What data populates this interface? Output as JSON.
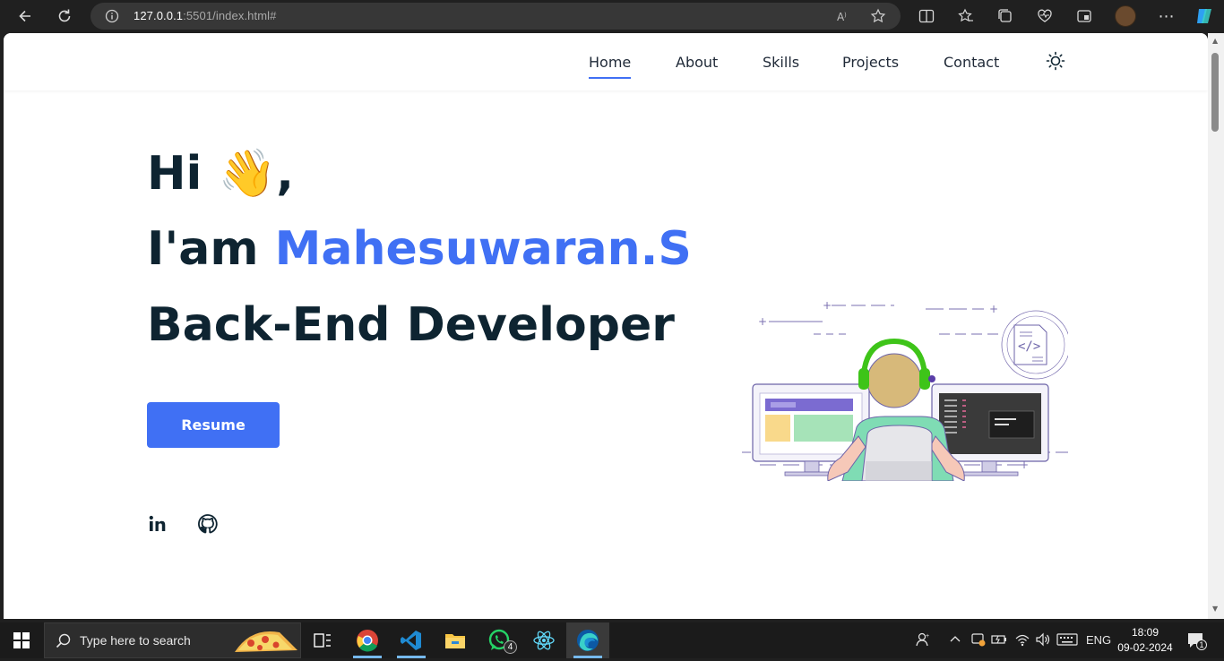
{
  "browser": {
    "url_host": "127.0.0.1",
    "url_rest": ":5501/index.html#"
  },
  "nav": {
    "items": [
      {
        "label": "Home",
        "active": true
      },
      {
        "label": "About"
      },
      {
        "label": "Skills"
      },
      {
        "label": "Projects"
      },
      {
        "label": "Contact"
      }
    ]
  },
  "hero": {
    "greeting": "Hi",
    "greeting_emoji": "👋",
    "greeting_suffix": ",",
    "intro_prefix": "I'am",
    "name": "Mahesuwaran.S",
    "role": "Back-End Developer",
    "resume_label": "Resume",
    "accent_color": "#4070f4"
  },
  "taskbar": {
    "search_placeholder": "Type here to search",
    "whatsapp_badge": "4",
    "language": "ENG",
    "time": "18:09",
    "date": "09-02-2024",
    "notification_count": "1"
  }
}
